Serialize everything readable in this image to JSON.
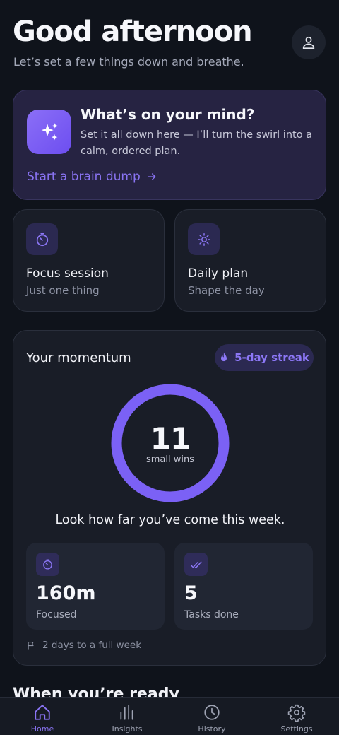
{
  "header": {
    "greeting": "Good afternoon",
    "subtitle": "Let’s set a few things down and breathe."
  },
  "profile": {
    "icon": "user-icon"
  },
  "brain_dump": {
    "icon": "sparkles-icon",
    "title": "What’s on your mind?",
    "description": "Set it all down here — I’ll turn the swirl into a calm, ordered plan.",
    "link_label": "Start a brain dump",
    "link_icon": "arrow-right-icon"
  },
  "quick_actions": [
    {
      "icon": "timer-icon",
      "title": "Focus session",
      "subtitle": "Just one thing"
    },
    {
      "icon": "sun-icon",
      "title": "Daily plan",
      "subtitle": "Shape the day"
    }
  ],
  "momentum": {
    "title": "Your momentum",
    "streak_label": "5-day streak",
    "streak_icon": "flame-icon",
    "wins_count": "11",
    "wins_label": "small wins",
    "ring_progress": 1.0,
    "message": "Look how far you’ve come this week.",
    "stats": [
      {
        "icon": "timer-icon",
        "value": "160m",
        "label": "Focused"
      },
      {
        "icon": "check-double-icon",
        "value": "5",
        "label": "Tasks done"
      }
    ],
    "footnote": "2 days to a full week",
    "footnote_icon": "flag-icon"
  },
  "next_section": {
    "title": "When you’re ready"
  },
  "nav": {
    "items": [
      {
        "label": "Home",
        "icon": "home-icon",
        "active": true
      },
      {
        "label": "Insights",
        "icon": "bar-chart-icon",
        "active": false
      },
      {
        "label": "History",
        "icon": "clock-icon",
        "active": false
      },
      {
        "label": "Settings",
        "icon": "gear-icon",
        "active": false
      }
    ]
  },
  "colors": {
    "background": "#0f131b",
    "accent": "#7b61f5",
    "card": "#191d27",
    "brain_dump_card": "#262342"
  }
}
